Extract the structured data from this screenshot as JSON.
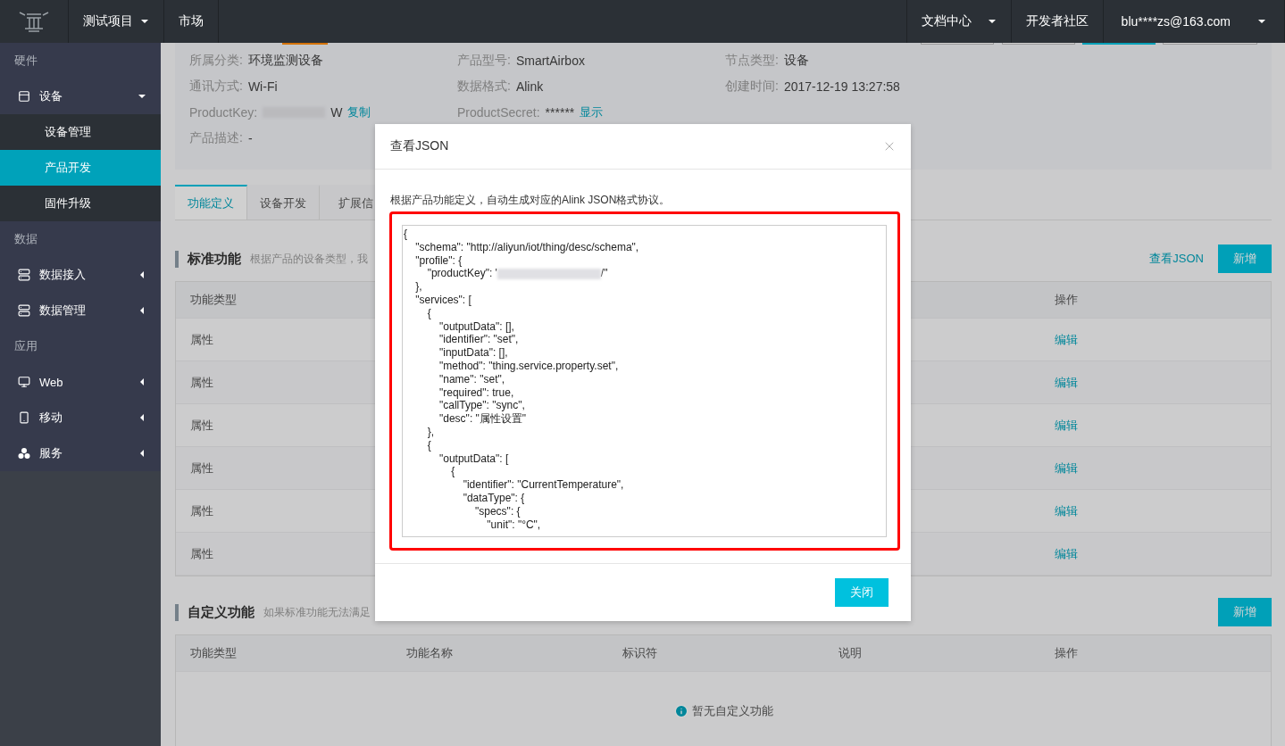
{
  "header": {
    "nav": [
      {
        "label": "测试项目",
        "dropdown": true
      },
      {
        "label": "市场",
        "dropdown": false
      }
    ],
    "right": [
      {
        "label": "文档中心",
        "dropdown": true
      },
      {
        "label": "开发者社区",
        "dropdown": false
      },
      {
        "label": "blu****zs@163.com",
        "dropdown": true
      }
    ]
  },
  "sidebar": [
    {
      "title": "硬件",
      "items": [
        {
          "label": "设备",
          "expanded": true,
          "children": [
            {
              "label": "设备管理",
              "selected": false
            },
            {
              "label": "产品开发",
              "selected": true
            },
            {
              "label": "固件升级",
              "selected": false
            }
          ]
        }
      ]
    },
    {
      "title": "数据",
      "items": [
        {
          "label": "数据接入",
          "expanded": false
        },
        {
          "label": "数据管理",
          "expanded": false
        }
      ]
    },
    {
      "title": "应用",
      "items": [
        {
          "label": "Web",
          "expanded": false
        },
        {
          "label": "移动",
          "expanded": false
        },
        {
          "label": "服务",
          "expanded": false
        }
      ]
    }
  ],
  "product_info": [
    [
      {
        "label": "所属分类:",
        "value": "环境监测设备"
      },
      {
        "label": "产品型号:",
        "value": "SmartAirbox"
      },
      {
        "label": "节点类型:",
        "value": "设备"
      }
    ],
    [
      {
        "label": "通讯方式:",
        "value": "Wi-Fi"
      },
      {
        "label": "数据格式:",
        "value": "Alink"
      },
      {
        "label": "创建时间:",
        "value": "2017-12-19 13:27:58"
      }
    ],
    [
      {
        "label": "ProductKey:",
        "value": "W",
        "redacted": true,
        "action": "复制"
      },
      {
        "label": "ProductSecret:",
        "value": "******",
        "action": "显示"
      }
    ],
    [
      {
        "label": "产品描述:",
        "value": "-"
      }
    ]
  ],
  "tabs": [
    {
      "label": "功能定义",
      "selected": true
    },
    {
      "label": "设备开发",
      "selected": false
    },
    {
      "label": "扩展信",
      "selected": false
    }
  ],
  "standard": {
    "title": "标准功能",
    "hint": "根据产品的设备类型，我",
    "link": "查看JSON",
    "button": "新增",
    "columns": [
      "功能类型",
      "操作"
    ],
    "rows": [
      {
        "type": "属性",
        "action": "编辑"
      },
      {
        "type": "属性",
        "action": "编辑"
      },
      {
        "type": "属性",
        "action": "编辑"
      },
      {
        "type": "属性",
        "action": "编辑"
      },
      {
        "type": "属性",
        "action": "编辑"
      },
      {
        "type": "属性",
        "action": "编辑"
      }
    ]
  },
  "custom": {
    "title": "自定义功能",
    "hint": "如果标准功能无法满足",
    "button": "新增",
    "columns": [
      "功能类型",
      "功能名称",
      "标识符",
      "说明",
      "操作"
    ],
    "empty": "暂无自定义功能"
  },
  "modal": {
    "title": "查看JSON",
    "description": "根据产品功能定义，自动生成对应的Alink JSON格式协议。",
    "button": "关闭",
    "code": [
      {
        "text": "{"
      },
      {
        "text": "    \"schema\": \"http://aliyun/iot/thing/desc/schema\","
      },
      {
        "text": "    \"profile\": {"
      },
      {
        "text": "        \"productKey\": '",
        "redacted": true,
        "after": "/\""
      },
      {
        "text": "    },"
      },
      {
        "text": "    \"services\": ["
      },
      {
        "text": "        {"
      },
      {
        "text": "            \"outputData\": [],"
      },
      {
        "text": "            \"identifier\": \"set\","
      },
      {
        "text": "            \"inputData\": [],"
      },
      {
        "text": "            \"method\": \"thing.service.property.set\","
      },
      {
        "text": "            \"name\": \"set\","
      },
      {
        "text": "            \"required\": true,"
      },
      {
        "text": "            \"callType\": \"sync\","
      },
      {
        "text": "            \"desc\": \"属性设置\""
      },
      {
        "text": "        },"
      },
      {
        "text": "        {"
      },
      {
        "text": "            \"outputData\": ["
      },
      {
        "text": "                {"
      },
      {
        "text": "                    \"identifier\": \"CurrentTemperature\","
      },
      {
        "text": "                    \"dataType\": {"
      },
      {
        "text": "                        \"specs\": {"
      },
      {
        "text": "                            \"unit\": \"°C\","
      }
    ]
  }
}
